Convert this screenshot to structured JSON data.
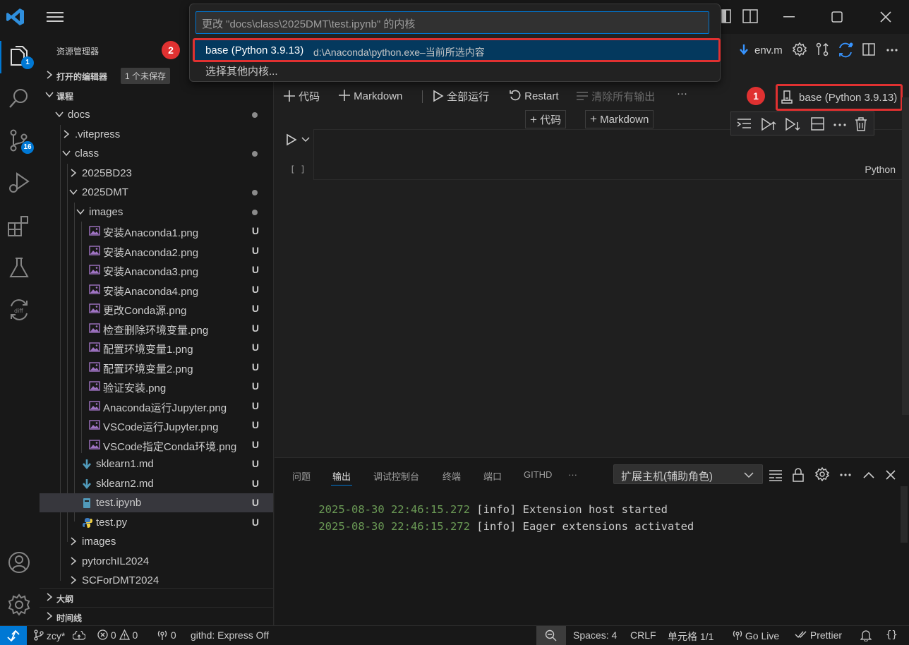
{
  "sidebar": {
    "title": "资源管理器",
    "open_editors": {
      "label": "打开的编辑器",
      "badge": "1 个未保存"
    },
    "workspace": {
      "label": "课程"
    },
    "tree": [
      {
        "name": "docs",
        "status": "dot"
      },
      {
        "name": ".vitepress",
        "status": ""
      },
      {
        "name": "class",
        "status": "dot"
      },
      {
        "name": "2025BD23",
        "status": ""
      },
      {
        "name": "2025DMT",
        "status": "dot"
      },
      {
        "name": "images",
        "status": "dot"
      },
      {
        "name": "安装Anaconda1.png",
        "status": "U"
      },
      {
        "name": "安装Anaconda2.png",
        "status": "U"
      },
      {
        "name": "安装Anaconda3.png",
        "status": "U"
      },
      {
        "name": "安装Anaconda4.png",
        "status": "U"
      },
      {
        "name": "更改Conda源.png",
        "status": "U"
      },
      {
        "name": "检查删除环境变量.png",
        "status": "U"
      },
      {
        "name": "配置环境变量1.png",
        "status": "U"
      },
      {
        "name": "配置环境变量2.png",
        "status": "U"
      },
      {
        "name": "验证安装.png",
        "status": "U"
      },
      {
        "name": "Anaconda运行Jupyter.png",
        "status": "U"
      },
      {
        "name": "VSCode运行Jupyter.png",
        "status": "U"
      },
      {
        "name": "VSCode指定Conda环境.png",
        "status": "U"
      },
      {
        "name": "sklearn1.md",
        "status": "U"
      },
      {
        "name": "sklearn2.md",
        "status": "U"
      },
      {
        "name": "test.ipynb",
        "status": "U"
      },
      {
        "name": "test.py",
        "status": "U"
      },
      {
        "name": "images",
        "status": ""
      },
      {
        "name": "pytorchIL2024",
        "status": ""
      },
      {
        "name": "SCForDMT2024",
        "status": ""
      }
    ],
    "outline": "大纲",
    "timeline": "时间线"
  },
  "activity_badges": {
    "explorer": "1",
    "scm": "16"
  },
  "editor": {
    "tab_file": "env.m",
    "toolbar": {
      "code": "代码",
      "markdown": "Markdown",
      "run_all": "全部运行",
      "restart": "Restart",
      "clear_outputs": "清除所有输出",
      "more": "···"
    },
    "kernel": "base (Python 3.9.13)",
    "marker_1": "1",
    "insert_code": "代码",
    "insert_markdown": "Markdown",
    "cell": {
      "exec_count": "[ ]",
      "language": "Python"
    }
  },
  "palette": {
    "placeholder": "更改 \"docs\\class\\2025DMT\\test.ipynb\" 的内核",
    "selected_item": "base (Python 3.9.13)",
    "selected_desc": "d:\\Anaconda\\python.exe–当前所选内容",
    "other_item": "选择其他内核...",
    "marker_2": "2"
  },
  "panel": {
    "tabs": [
      "问题",
      "输出",
      "调试控制台",
      "终端",
      "端口",
      "GITHD",
      "···"
    ],
    "active_tab": 1,
    "channel": "扩展主机(辅助角色)",
    "log": [
      {
        "ts": "2025-08-30 22:46:15.272",
        "msg": " [info] Extension host started"
      },
      {
        "ts": "2025-08-30 22:46:15.272",
        "msg": " [info] Eager extensions activated"
      }
    ]
  },
  "statusbar": {
    "branch": "zcy*",
    "errors": "0",
    "warnings": "0",
    "ports": "0",
    "githd": "githd: Express Off",
    "spaces": "Spaces: 4",
    "eol": "CRLF",
    "cell": "单元格 1/1",
    "golive": "Go Live",
    "prettier": "Prettier",
    "braces": "{}"
  },
  "colors": {
    "accent": "#0078d4",
    "highlight_red": "#e03131",
    "selection": "#04395e"
  }
}
